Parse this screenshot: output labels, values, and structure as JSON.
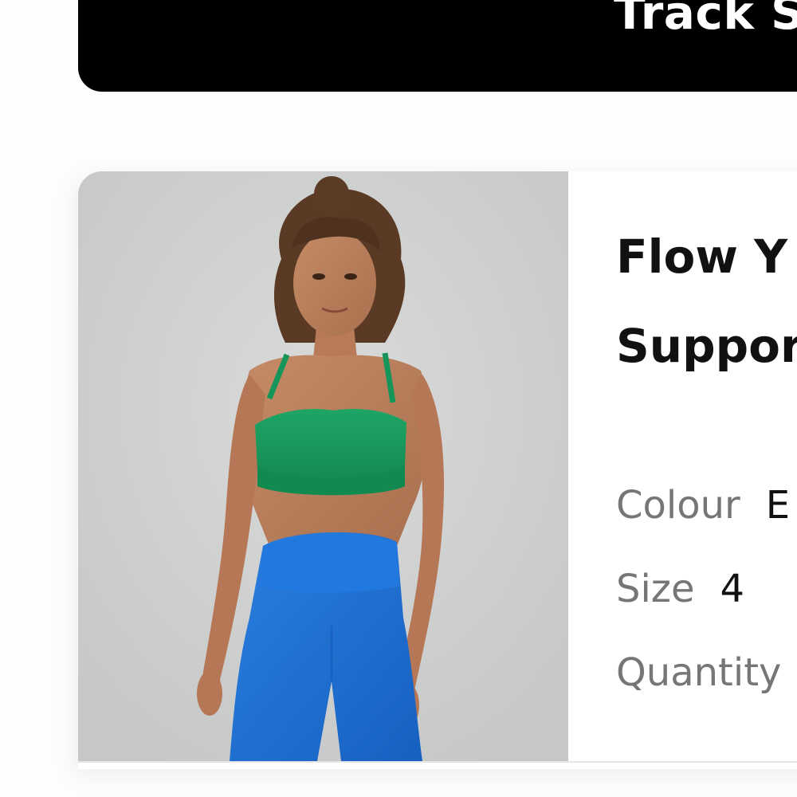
{
  "banner": {
    "label": "Track S"
  },
  "product": {
    "image_alt": "Woman wearing green sports bra and blue leggings",
    "title_line1": "Flow Y",
    "title_line2": "Suppor",
    "attributes": {
      "colour_label": "Colour",
      "colour_value": "E",
      "size_label": "Size",
      "size_value": "4",
      "quantity_label": "Quantity"
    }
  },
  "colors": {
    "banner_bg": "#000000",
    "bra_green": "#16955a",
    "leggings_blue": "#1c6fd2",
    "image_bg": "#d0d1d1",
    "label_gray": "#767676"
  }
}
